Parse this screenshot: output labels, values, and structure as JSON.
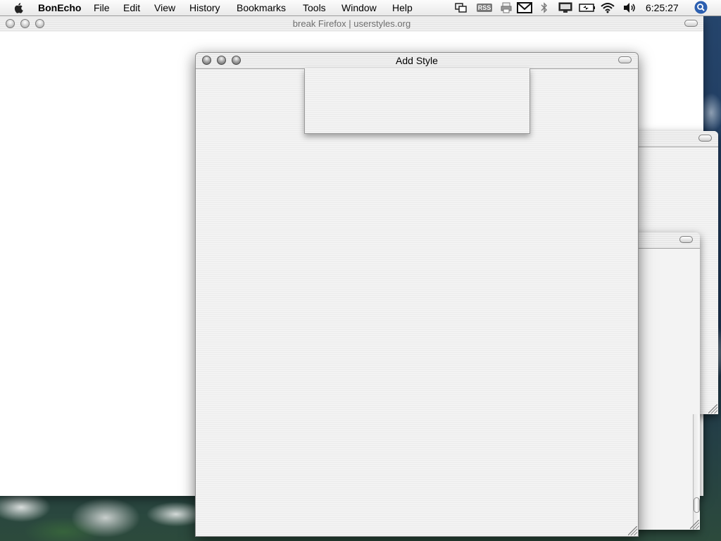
{
  "menubar": {
    "app_name": "BonEcho",
    "items": [
      {
        "label": "File"
      },
      {
        "label": "Edit"
      },
      {
        "label": "View"
      },
      {
        "label": "History"
      },
      {
        "label": "Bookmarks"
      },
      {
        "label": "Tools"
      },
      {
        "label": "Window"
      },
      {
        "label": "Help"
      }
    ],
    "status_icons": [
      "screen-sharing-icon",
      "rss-icon",
      "printer-icon",
      "mail-icon",
      "bluetooth-icon",
      "display-icon",
      "battery-icon",
      "wifi-icon",
      "volume-icon",
      "spotlight-icon"
    ],
    "rss_label": "RSS",
    "clock": "6:25:27"
  },
  "firefox_window": {
    "title": "break Firefox | userstyles.org"
  },
  "add_style_window": {
    "title": "Add Style"
  },
  "colors": {
    "menubar_bg": "#f0f0f0",
    "window_bg": "#f2f2f2",
    "content_bg": "#ffffff"
  }
}
